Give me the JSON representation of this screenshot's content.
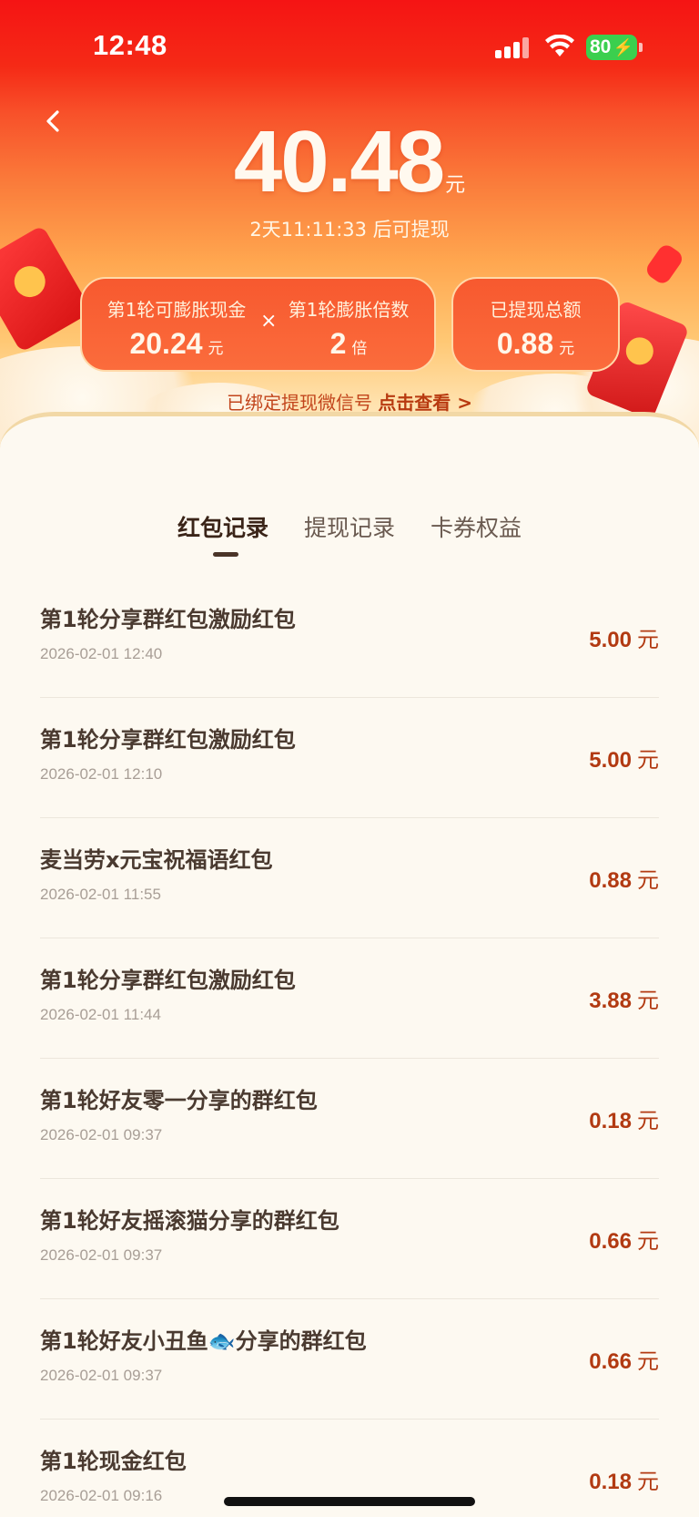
{
  "status_bar": {
    "time": "12:48",
    "battery": "80"
  },
  "header": {
    "balance": "40.48",
    "balance_unit": "元",
    "countdown": "2天11:11:33 后可提现"
  },
  "stats": {
    "expandable_cash_label": "第1轮可膨胀现金",
    "expandable_cash_value": "20.24",
    "expandable_cash_unit": "元",
    "times_sign": "×",
    "multiplier_label": "第1轮膨胀倍数",
    "multiplier_value": "2",
    "multiplier_unit": "倍",
    "withdrawn_label": "已提现总额",
    "withdrawn_value": "0.88",
    "withdrawn_unit": "元"
  },
  "binding": {
    "text": "已绑定提现微信号",
    "link": "点击查看 >"
  },
  "tabs": [
    {
      "label": "红包记录",
      "active": true
    },
    {
      "label": "提现记录",
      "active": false
    },
    {
      "label": "卡券权益",
      "active": false
    }
  ],
  "records": [
    {
      "title": "第1轮分享群红包激励红包",
      "date": "2026-02-01 12:40",
      "amount": "5.00",
      "unit": "元"
    },
    {
      "title": "第1轮分享群红包激励红包",
      "date": "2026-02-01 12:10",
      "amount": "5.00",
      "unit": "元"
    },
    {
      "title": "麦当劳x元宝祝福语红包",
      "date": "2026-02-01 11:55",
      "amount": "0.88",
      "unit": "元"
    },
    {
      "title": "第1轮分享群红包激励红包",
      "date": "2026-02-01 11:44",
      "amount": "3.88",
      "unit": "元"
    },
    {
      "title": "第1轮好友零一分享的群红包",
      "date": "2026-02-01 09:37",
      "amount": "0.18",
      "unit": "元"
    },
    {
      "title": "第1轮好友摇滚猫分享的群红包",
      "date": "2026-02-01 09:37",
      "amount": "0.66",
      "unit": "元"
    },
    {
      "title": "第1轮好友小丑鱼🐟分享的群红包",
      "date": "2026-02-01 09:37",
      "amount": "0.66",
      "unit": "元"
    },
    {
      "title": "第1轮现金红包",
      "date": "2026-02-01 09:16",
      "amount": "0.18",
      "unit": "元"
    }
  ],
  "colors": {
    "accent": "#f51414",
    "amount": "#b23a12"
  }
}
